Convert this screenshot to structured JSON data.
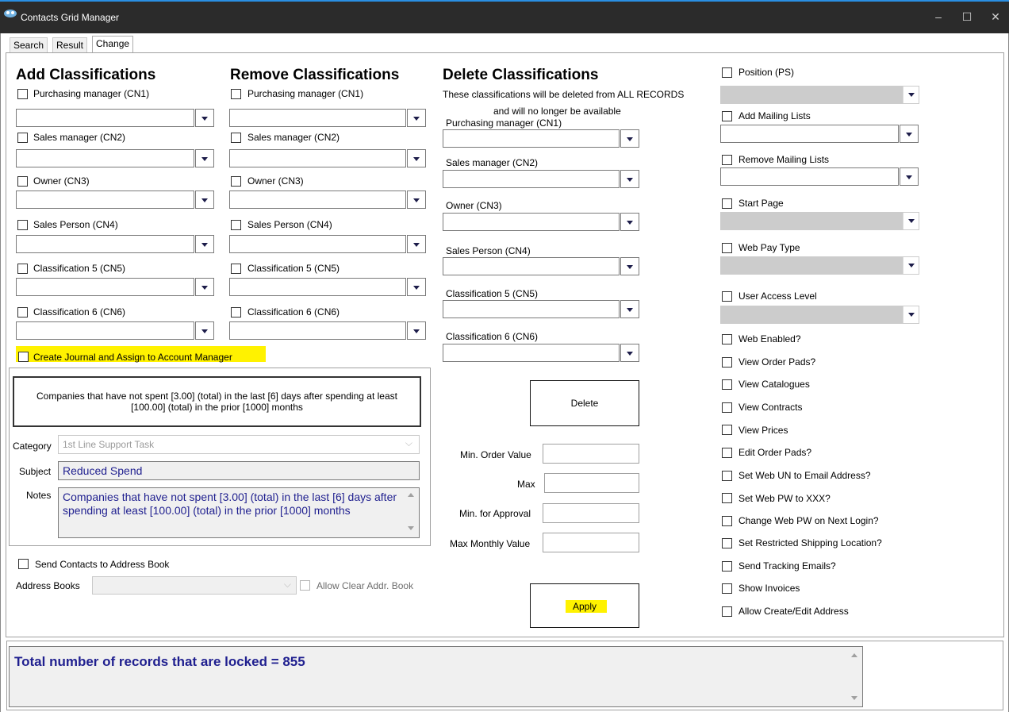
{
  "window": {
    "title": "Contacts Grid Manager",
    "minimize": "–",
    "maximize": "☐",
    "close": "✕"
  },
  "tabs": [
    {
      "label": "Search"
    },
    {
      "label": "Result"
    },
    {
      "label": "Change"
    }
  ],
  "add": {
    "heading": "Add Classifications",
    "items": [
      {
        "label": "Purchasing manager (CN1)"
      },
      {
        "label": "Sales manager (CN2)"
      },
      {
        "label": "Owner (CN3)"
      },
      {
        "label": "Sales Person (CN4)"
      },
      {
        "label": "Classification 5 (CN5)"
      },
      {
        "label": "Classification 6 (CN6)"
      }
    ]
  },
  "remove": {
    "heading": "Remove Classifications",
    "items": [
      {
        "label": "Purchasing manager (CN1)"
      },
      {
        "label": "Sales manager (CN2)"
      },
      {
        "label": "Owner (CN3)"
      },
      {
        "label": "Sales Person (CN4)"
      },
      {
        "label": "Classification 5 (CN5)"
      },
      {
        "label": "Classification 6 (CN6)"
      }
    ]
  },
  "delete": {
    "heading": "Delete Classifications",
    "note_line1": "These classifications will be deleted from ALL RECORDS",
    "note_line2": "and will no longer be available",
    "items": [
      {
        "label": "Purchasing manager (CN1)"
      },
      {
        "label": "Sales manager (CN2)"
      },
      {
        "label": "Owner (CN3)"
      },
      {
        "label": "Sales Person (CN4)"
      },
      {
        "label": "Classification 5 (CN5)"
      },
      {
        "label": "Classification 6 (CN6)"
      }
    ],
    "button": "Delete"
  },
  "journal": {
    "checkbox_label": "Create Journal and Assign to Account Manager",
    "summary": "Companies that have not spent [3.00] (total) in the last [6] days after spending at least [100.00] (total) in the prior [1000] months",
    "category_label": "Category",
    "category_value": "1st Line Support Task",
    "subject_label": "Subject",
    "subject_value": "Reduced Spend",
    "notes_label": "Notes",
    "notes_value": "Companies that have not spent [3.00] (total) in the last [6] days after spending at least [100.00] (total) in the prior [1000] months"
  },
  "address": {
    "send_label": "Send Contacts to Address Book",
    "books_label": "Address Books",
    "allow_clear_label": "Allow Clear Addr. Book"
  },
  "order_values": {
    "min_order_label": "Min. Order Value",
    "max_label": "Max",
    "min_approval_label": "Min. for Approval",
    "max_monthly_label": "Max Monthly Value"
  },
  "apply_button": "Apply",
  "right": {
    "position": "Position (PS)",
    "add_mailing": "Add Mailing Lists",
    "remove_mailing": "Remove Mailing Lists",
    "start_page": "Start Page",
    "web_pay_type": "Web Pay Type",
    "user_access": "User Access Level",
    "checks": [
      {
        "label": "Web Enabled?"
      },
      {
        "label": "View Order Pads?"
      },
      {
        "label": "View Catalogues"
      },
      {
        "label": "View Contracts"
      },
      {
        "label": "View Prices"
      },
      {
        "label": "Edit Order Pads?"
      },
      {
        "label": "Set Web UN to Email Address?"
      },
      {
        "label": "Set Web PW to XXX?"
      },
      {
        "label": "Change Web PW on Next Login?"
      },
      {
        "label": "Set Restricted Shipping Location?"
      },
      {
        "label": "Send Tracking Emails?"
      },
      {
        "label": "Show Invoices"
      },
      {
        "label": "Allow Create/Edit Address"
      }
    ]
  },
  "status": {
    "text": "Total number of records that are locked = 855"
  },
  "colors": {
    "highlight": "#fff200",
    "navy_text": "#1f1f8f",
    "titlebar": "#2b2b2b"
  }
}
